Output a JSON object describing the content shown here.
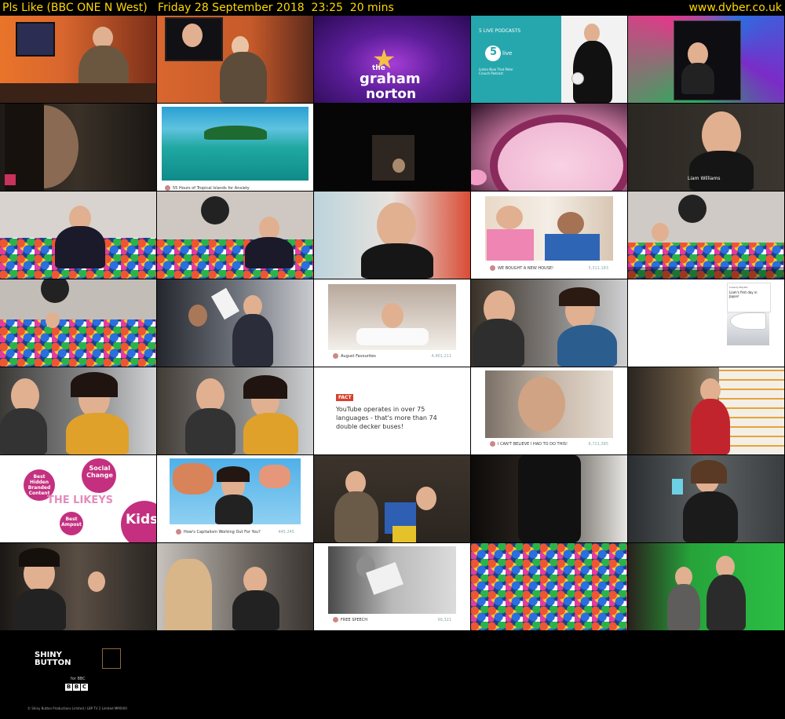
{
  "header": {
    "title": "Pls Like (BBC ONE N West)   Friday 28 September 2018  23:25  20 mins",
    "site": "www.dvber.co.uk"
  },
  "thumbs": {
    "t7": {
      "caption": "55 Hours of Tropical Islands for Anxiety",
      "stat": ""
    },
    "t10": {
      "caption": "Liam Williams"
    },
    "t19": {
      "caption": "WE BOUGHT A NEW HOUSE!",
      "stat": "5,311,183"
    },
    "t23": {
      "caption": "August Favourites",
      "stat": "4,401,211"
    },
    "t25": {
      "line1": "Lowerly Mayfair",
      "line2": "Liam's first day in Japan!"
    },
    "t28": {
      "label": "FACT",
      "text": "YouTube operates in over 75 languages - that's more than 74 double decker buses!"
    },
    "t29": {
      "caption": "I CAN'T BELIEVE I HAD TO DO THIS!",
      "stat": "8,721,385"
    },
    "t31": {
      "social": "Social Change",
      "best": "Best Hidden Branded Content",
      "likeys": "THE LIKEYS",
      "bestamp": "Best Ampost",
      "kids": "Kids"
    },
    "t32": {
      "caption": "How's Capitalism Working Out For You?",
      "stat": "445,245"
    },
    "t38": {
      "caption": "FREE SPEECH",
      "stat": "99,321"
    },
    "t3": {
      "line1": "the",
      "line2": "graham",
      "line3": "norton"
    },
    "t4": {
      "heading": "5 LIVE PODCASTS",
      "sub": "Listen Now That Peter Crouch Podcast",
      "five": "5",
      "live": "live"
    }
  },
  "footer": {
    "shiny": "SHINY BUTTON",
    "for": "for BBC",
    "bbc": [
      "B",
      "B",
      "C"
    ],
    "credits": "© Shiny Button Productions Limited / LBP TV 2 Limited MMXVIII"
  },
  "colors": {
    "header_text": "#ffd800",
    "background": "#000000"
  }
}
